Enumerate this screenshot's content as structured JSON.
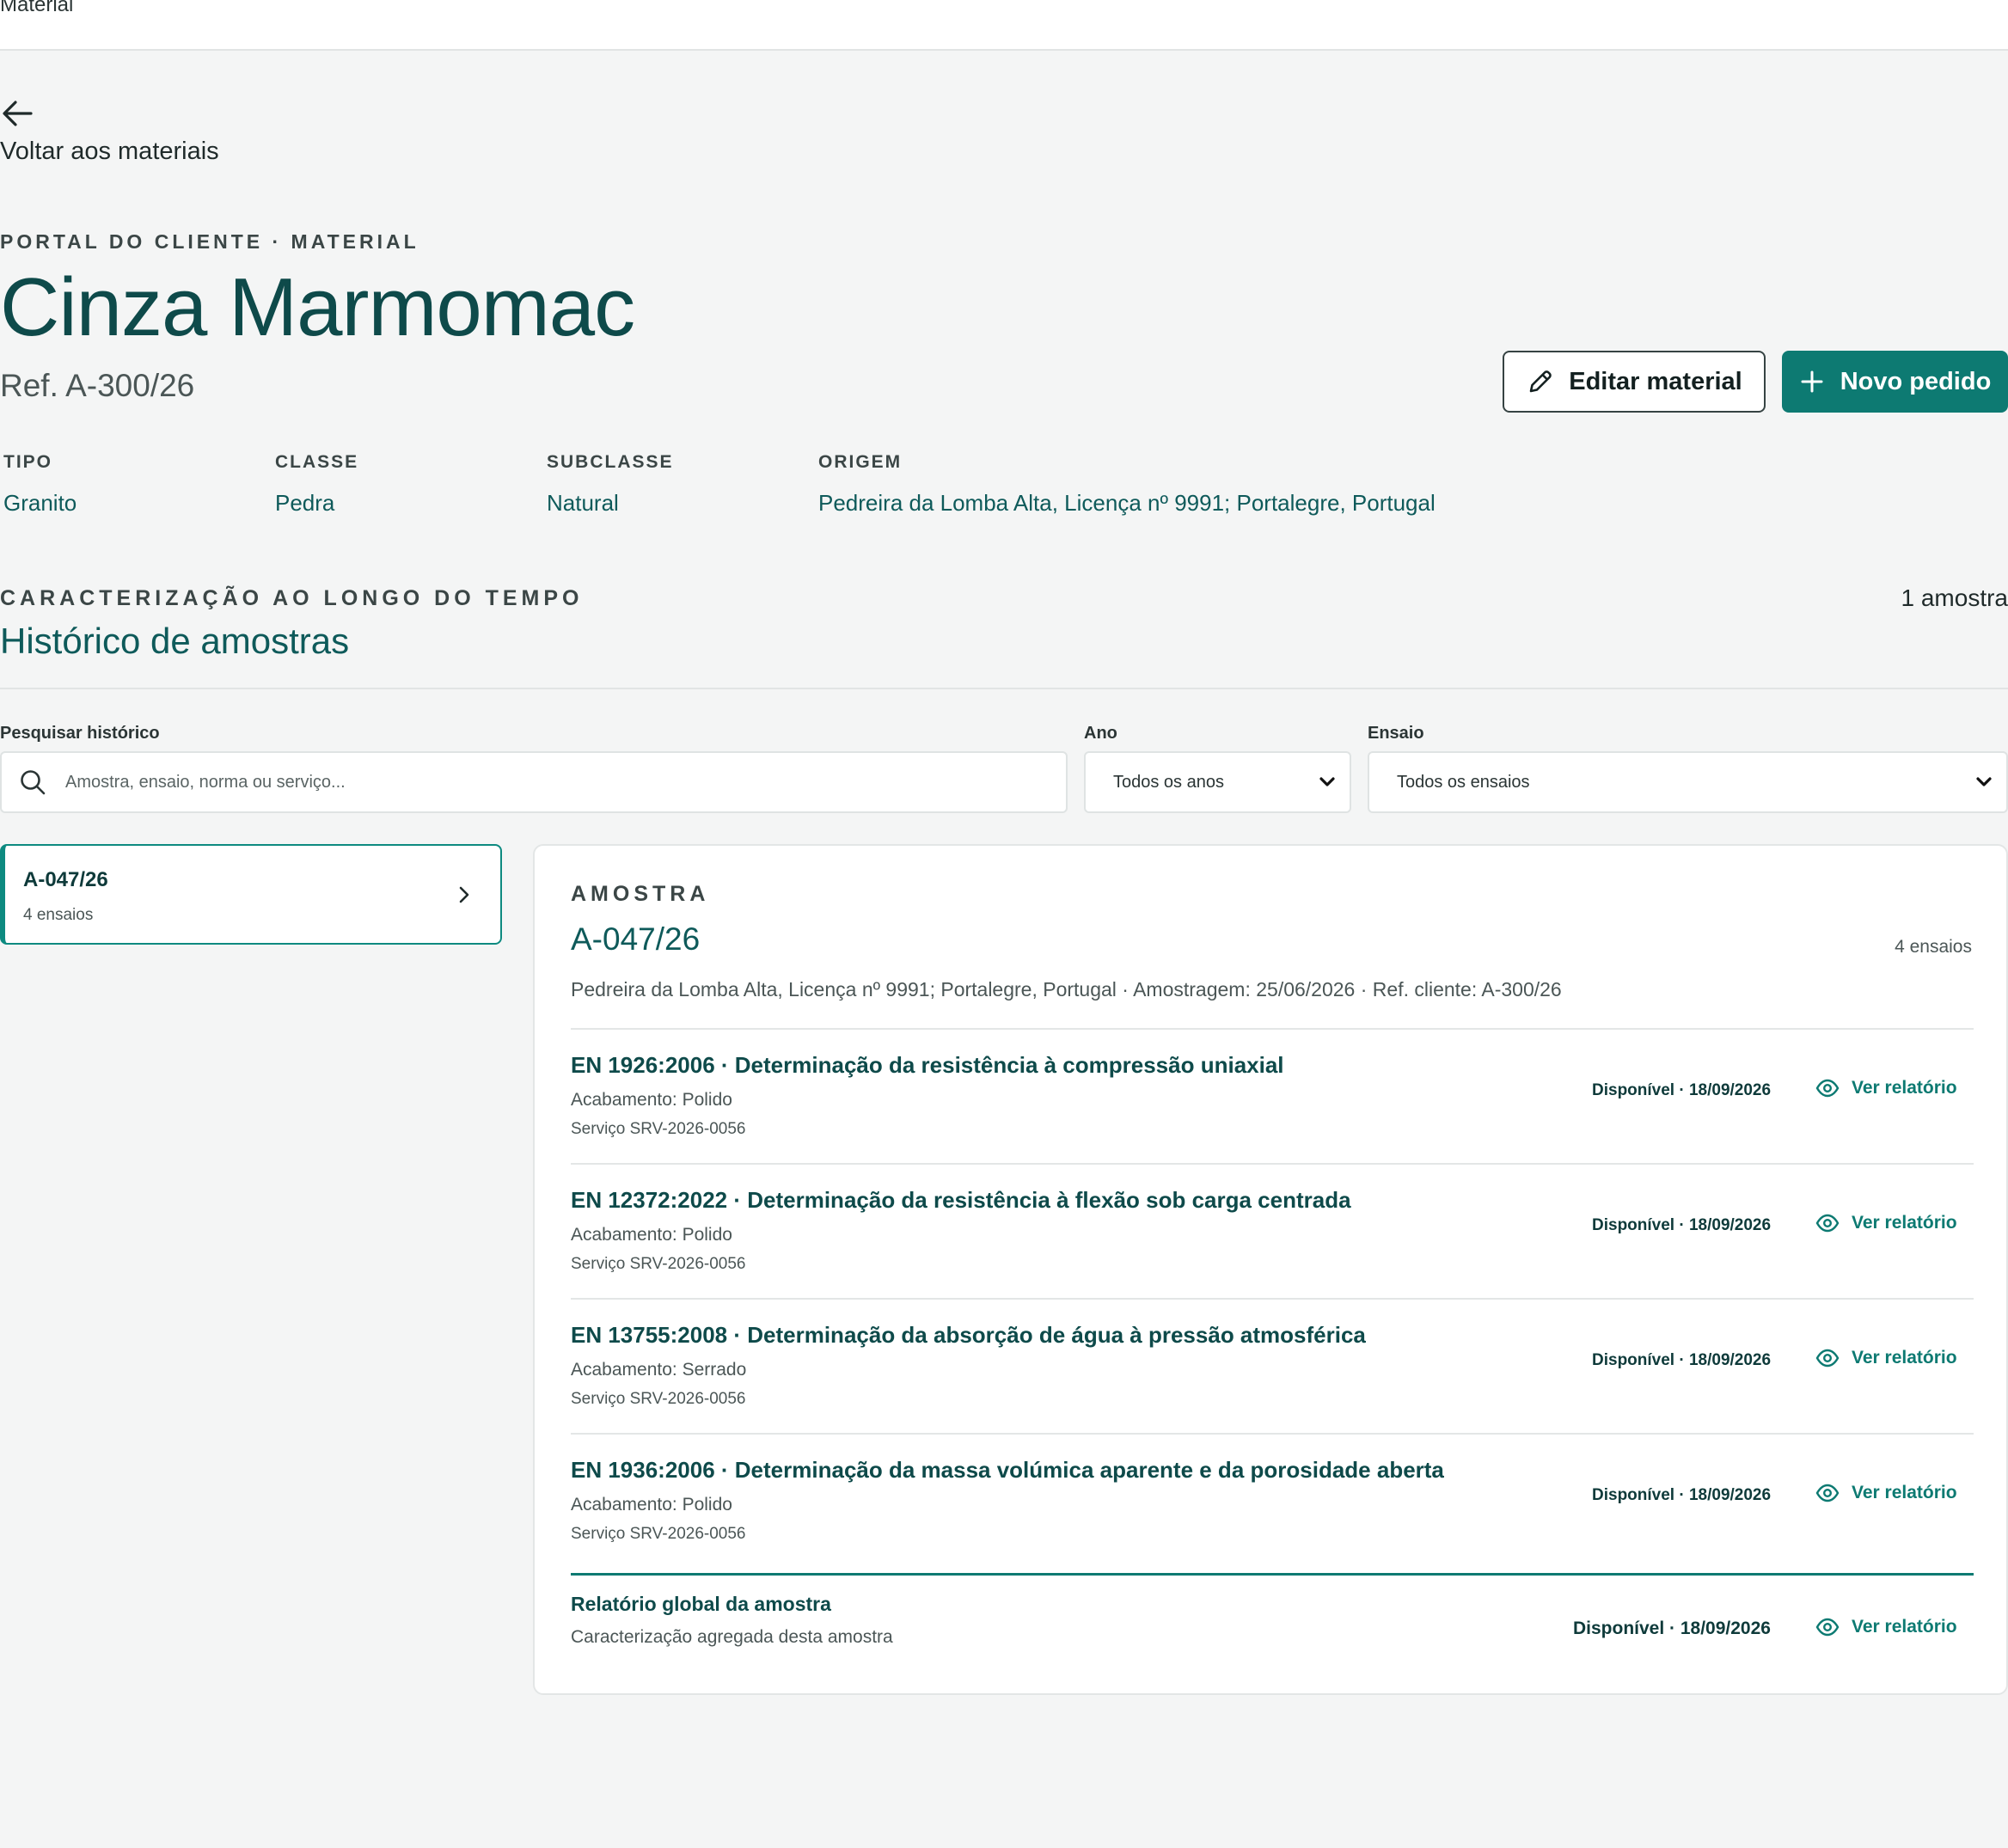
{
  "topbar": {
    "crumb": "Material"
  },
  "back": {
    "label": "Voltar aos materiais"
  },
  "header": {
    "eyebrow": "PORTAL DO CLIENTE · MATERIAL",
    "title": "Cinza Marmomac",
    "ref": "Ref. A-300/26",
    "edit_label": "Editar material",
    "new_label": "Novo pedido"
  },
  "meta": [
    {
      "label": "TIPO",
      "value": "Granito"
    },
    {
      "label": "CLASSE",
      "value": "Pedra"
    },
    {
      "label": "SUBCLASSE",
      "value": "Natural"
    },
    {
      "label": "ORIGEM",
      "value": "Pedreira da Lomba Alta, Licença nº 9991; Portalegre, Portugal"
    }
  ],
  "history": {
    "eyebrow": "CARACTERIZAÇÃO AO LONGO DO TEMPO",
    "title": "Histórico de amostras",
    "count": "1 amostra"
  },
  "filters": {
    "search_label": "Pesquisar histórico",
    "search_placeholder": "Amostra, ensaio, norma ou serviço...",
    "year_label": "Ano",
    "year_value": "Todos os anos",
    "test_label": "Ensaio",
    "test_value": "Todos os ensaios"
  },
  "samples": [
    {
      "id": "A-047/26",
      "count": "4 ensaios"
    }
  ],
  "detail": {
    "eyebrow": "AMOSTRA",
    "title": "A-047/26",
    "count": "4 ensaios",
    "description": "Pedreira da Lomba Alta, Licença nº 9991; Portalegre, Portugal · Amostragem: 25/06/2026 · Ref. cliente: A-300/26",
    "tests": [
      {
        "title": "EN 1926:2006 · Determinação da resistência à compressão uniaxial",
        "finish": "Acabamento: Polido",
        "service": "Serviço SRV-2026-0056",
        "status": "Disponível · 18/09/2026",
        "action": "Ver relatório"
      },
      {
        "title": "EN 12372:2022 · Determinação da resistência à flexão sob carga centrada",
        "finish": "Acabamento: Polido",
        "service": "Serviço SRV-2026-0056",
        "status": "Disponível · 18/09/2026",
        "action": "Ver relatório"
      },
      {
        "title": "EN 13755:2008 · Determinação da absorção de água à pressão atmosférica",
        "finish": "Acabamento: Serrado",
        "service": "Serviço SRV-2026-0056",
        "status": "Disponível · 18/09/2026",
        "action": "Ver relatório"
      },
      {
        "title": "EN 1936:2006 · Determinação da massa volúmica aparente e da porosidade aberta",
        "finish": "Acabamento: Polido",
        "service": "Serviço SRV-2026-0056",
        "status": "Disponível · 18/09/2026",
        "action": "Ver relatório"
      }
    ],
    "global": {
      "title": "Relatório global da amostra",
      "description": "Caracterização agregada desta amostra",
      "status": "Disponível · 18/09/2026",
      "action": "Ver relatório"
    }
  },
  "colors": {
    "accent": "#0d7a72",
    "heading": "#0e4a4a",
    "background": "#f4f5f5"
  }
}
